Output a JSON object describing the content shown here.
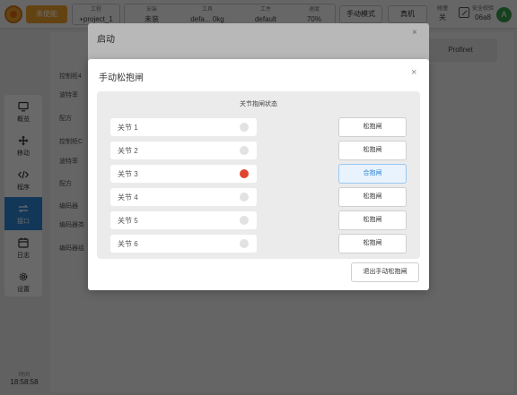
{
  "topbar": {
    "enable_label": "未使能",
    "project": {
      "label": "工程",
      "value": "+project_1"
    },
    "safety": {
      "label": "安装",
      "value": "未装"
    },
    "tool": {
      "label": "工具",
      "value": "defa..."
    },
    "load": {
      "value": "0kg"
    },
    "workpiece": {
      "label": "工件",
      "value": "default"
    },
    "speed": {
      "label": "速度",
      "value": "70%"
    },
    "manual_mode": "手动模式",
    "real_machine": "真机",
    "brake": {
      "label": "碰撞",
      "value": "关"
    },
    "safety_check": {
      "label": "安全校验",
      "value": "06a8"
    },
    "avatar": "A"
  },
  "sidebar": {
    "items": [
      {
        "icon": "monitor-icon",
        "label": "概览"
      },
      {
        "icon": "move-icon",
        "label": "移动"
      },
      {
        "icon": "code-icon",
        "label": "程序"
      },
      {
        "icon": "interface-icon",
        "label": "接口"
      },
      {
        "icon": "calendar-icon",
        "label": "日志"
      },
      {
        "icon": "gear-icon",
        "label": "设置"
      }
    ],
    "active_index": 3
  },
  "clock": {
    "label": "时间",
    "value": "18:58:58"
  },
  "background": {
    "tab_profinet": "Profinet",
    "labels": [
      "控制柜4",
      "波特率",
      "配方",
      "控制柜C",
      "波特率",
      "配方",
      "编码器",
      "编码器类",
      "编码器组"
    ]
  },
  "outer_dialog": {
    "title": "启动",
    "close": "×"
  },
  "dialog": {
    "title": "手动松抱闸",
    "close": "×",
    "panel_title": "关节抱闸状态",
    "joints": [
      {
        "name": "关节 1",
        "engaged": false,
        "button": "松抱闸"
      },
      {
        "name": "关节 2",
        "engaged": false,
        "button": "松抱闸"
      },
      {
        "name": "关节 3",
        "engaged": true,
        "button": "合抱闸"
      },
      {
        "name": "关节 4",
        "engaged": false,
        "button": "松抱闸"
      },
      {
        "name": "关节 5",
        "engaged": false,
        "button": "松抱闸"
      },
      {
        "name": "关节 6",
        "engaged": false,
        "button": "松抱闸"
      }
    ],
    "exit_button": "退出手动松抱闸"
  },
  "colors": {
    "accent": "#2d86d6",
    "warning": "#f0a030",
    "brake_active": "#e0452d"
  }
}
